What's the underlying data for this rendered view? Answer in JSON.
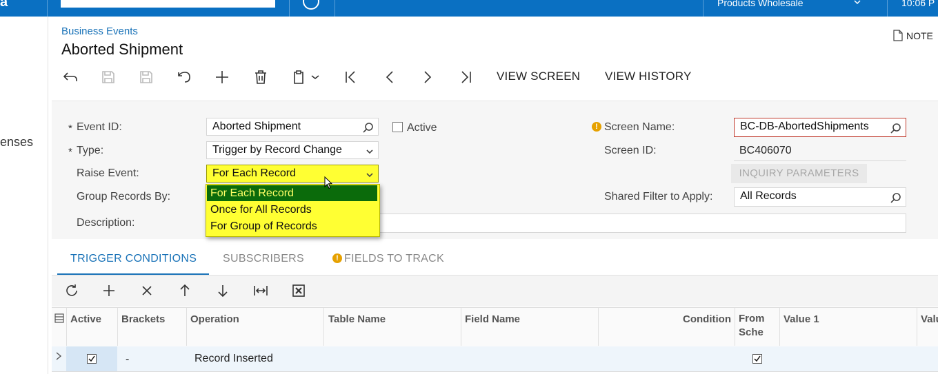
{
  "topbar": {
    "logo_fragment": "a",
    "tenant": "Products Wholesale",
    "clock": "10:06 P"
  },
  "leftrail": {
    "label_fragment": "enses"
  },
  "header": {
    "breadcrumb": "Business Events",
    "title": "Aborted Shipment",
    "notes_label": "NOTE"
  },
  "toolbar": {
    "view_screen": "VIEW SCREEN",
    "view_history": "VIEW HISTORY"
  },
  "form": {
    "event_id_label": "Event ID:",
    "event_id_value": "Aborted Shipment",
    "active_label": "Active",
    "active_checked": false,
    "type_label": "Type:",
    "type_value": "Trigger by Record Change",
    "raise_event_label": "Raise Event:",
    "raise_event_value": "For Each Record",
    "group_records_label": "Group Records By:",
    "description_label": "Description:",
    "description_value": "",
    "screen_name_label": "Screen Name:",
    "screen_name_value": "BC-DB-AbortedShipments",
    "screen_id_label": "Screen ID:",
    "screen_id_value": "BC406070",
    "inquiry_params_label": "INQUIRY PARAMETERS",
    "shared_filter_label": "Shared Filter to Apply:",
    "shared_filter_value": "All Records",
    "required_marker": "*",
    "warning_glyph": "!"
  },
  "raise_event_dropdown": {
    "options": [
      "For Each Record",
      "Once for All Records",
      "For Group of Records"
    ],
    "selected_index": 0
  },
  "tabs": [
    {
      "label": "TRIGGER CONDITIONS",
      "active": true
    },
    {
      "label": "SUBSCRIBERS",
      "active": false
    },
    {
      "label": "FIELDS TO TRACK",
      "active": false
    }
  ],
  "grid": {
    "columns": [
      "Active",
      "Brackets",
      "Operation",
      "Table Name",
      "Field Name",
      "Condition",
      "From",
      "Sche",
      "Value 1",
      "Valu"
    ],
    "rows": [
      {
        "active": true,
        "brackets": "-",
        "operation": "Record Inserted",
        "table_name": "",
        "field_name": "",
        "condition": "",
        "from_schema": true,
        "value1": ""
      }
    ]
  }
}
